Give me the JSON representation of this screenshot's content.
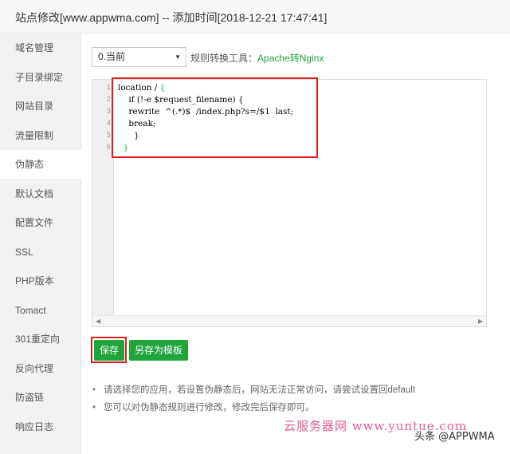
{
  "window": {
    "title": "站点修改[www.appwma.com] -- 添加时间[2018-12-21 17:47:41]"
  },
  "sidebar": {
    "items": [
      {
        "label": "域名管理"
      },
      {
        "label": "子目录绑定"
      },
      {
        "label": "网站目录"
      },
      {
        "label": "流量限制"
      },
      {
        "label": "伪静态",
        "active": true
      },
      {
        "label": "默认文档"
      },
      {
        "label": "配置文件"
      },
      {
        "label": "SSL"
      },
      {
        "label": "PHP版本"
      },
      {
        "label": "Tomact"
      },
      {
        "label": "301重定向"
      },
      {
        "label": "反向代理"
      },
      {
        "label": "防盗链"
      },
      {
        "label": "响应日志"
      }
    ]
  },
  "rewrite": {
    "template_select": "0.当前",
    "tool_label": "规则转换工具：",
    "tool_link": "Apache转Nginx"
  },
  "editor": {
    "line_numbers": [
      "1",
      "2",
      "3",
      "4",
      "5",
      "6"
    ],
    "lines": [
      {
        "text": "location / ",
        "bracket": "{"
      },
      {
        "text": "    if (!-e $request_filename) {",
        "bracket": ""
      },
      {
        "text": "    rewrite  ^(.*)$  /index.php?s=/$1  last;",
        "bracket": ""
      },
      {
        "text": "    break;",
        "bracket": ""
      },
      {
        "text": "      }",
        "bracket": ""
      },
      {
        "text": "  ",
        "bracket": "}"
      }
    ]
  },
  "buttons": {
    "save": "保存",
    "save_as_template": "另存为模板"
  },
  "tips": [
    "请选择您的应用，若设置伪静态后，网站无法正常访问，请尝试设置回default",
    "您可以对伪静态规则进行修改，修改完后保存即可。"
  ],
  "overlay": {
    "watermark": "云服务器网 www.yuntue.com",
    "credit": "头条 @APPWMA"
  },
  "colors": {
    "accent": "#20a53a",
    "highlight": "#e02020",
    "watermark": "#e05a9a"
  }
}
